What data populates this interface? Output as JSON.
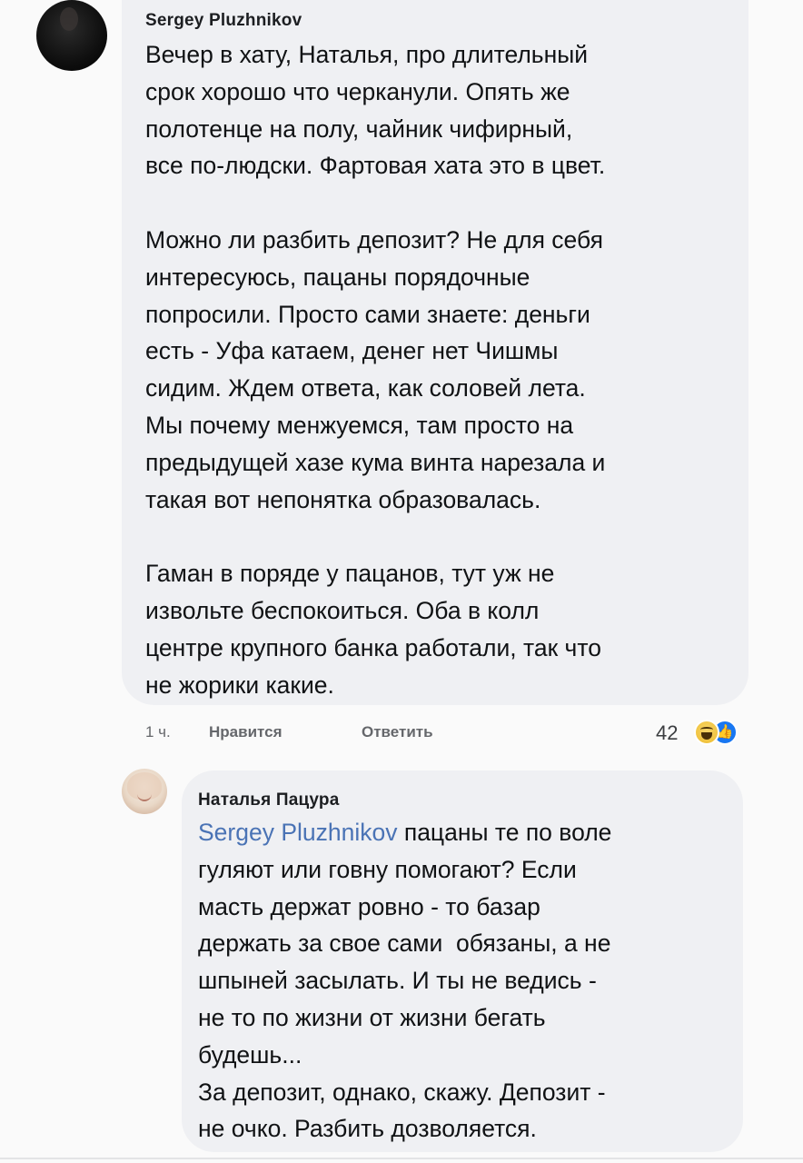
{
  "comment1": {
    "author": "Sergey Pluzhnikov",
    "paragraphs": [
      [
        "Вечер в хату, Наталья, про длительный",
        "срок хорошо что черканули. Опять же",
        "полотенце на полу, чайник чифирный,",
        "все по-людски. Фартовая хата это в цвет."
      ],
      [
        "Можно ли разбить депозит? Не для себя",
        "интересуюсь, пацаны порядочные",
        "попросили. Просто сами знаете: деньги",
        "есть - Уфа катаем, денег нет Чишмы",
        "сидим. Ждем ответа, как соловей лета.",
        "Мы почему менжуемся, там просто на",
        "предыдущей хазе кума винта нарезала и",
        "такая вот непонятка образовалась."
      ],
      [
        "Гаман в порядe у пацанов, тут уж не",
        "извольте беспокоиться. Оба в колл",
        "центре крупного банка работали, так что",
        "не жорики какие."
      ]
    ],
    "actions": {
      "time": "1 ч.",
      "like": "Нравится",
      "reply": "Ответить",
      "reaction_count": "42",
      "reactions": [
        "haha-icon",
        "like-icon"
      ]
    }
  },
  "comment2": {
    "author": "Наталья Пацура",
    "mention": "Sergey Pluzhnikov",
    "first_line_rest": " пацаны те по воле",
    "lines": [
      "гуляют или говну помогают? Если",
      "масть держат ровно - то базар",
      "держать за свое сами  обязаны, а не",
      "шпыней засылать. И ты не ведись -",
      "не то по жизни от жизни бегать",
      "будешь...",
      "За депозит, однако, скажу. Депозит -",
      "не очко. Разбить дозволяется."
    ]
  },
  "colors": {
    "bubble": "#eff0f3",
    "mention": "#4a73b5",
    "meta": "#65676b",
    "like_blue": "#1877f2"
  }
}
